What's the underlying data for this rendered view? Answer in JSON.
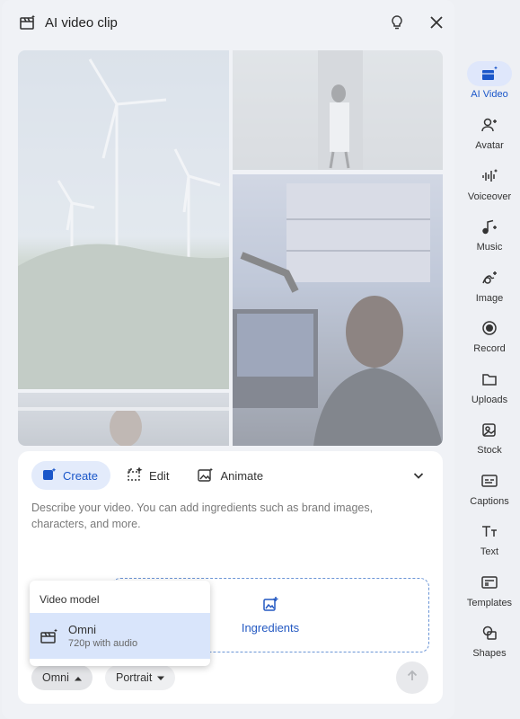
{
  "header": {
    "title": "AI video clip",
    "title_icon": "video-clip-sparkle-icon",
    "tip_icon": "lightbulb-icon",
    "close_icon": "close-icon"
  },
  "composer": {
    "tabs": [
      {
        "label": "Create",
        "icon": "create-sparkle-icon",
        "active": true
      },
      {
        "label": "Edit",
        "icon": "edit-frame-icon",
        "active": false
      },
      {
        "label": "Animate",
        "icon": "animate-image-icon",
        "active": false
      }
    ],
    "prompt_placeholder": "Describe your video. You can add ingredients such as brand images, characters, and more.",
    "ingredients_label": "Ingredients",
    "model_chip": "Omni",
    "aspect_chip": "Portrait"
  },
  "dropdown": {
    "header": "Video model",
    "items": [
      {
        "name": "Omni",
        "detail": "720p with audio",
        "selected": true
      }
    ]
  },
  "sidebar": {
    "items": [
      {
        "label": "AI Video",
        "icon": "ai-video-icon",
        "active": true
      },
      {
        "label": "Avatar",
        "icon": "avatar-icon",
        "active": false
      },
      {
        "label": "Voiceover",
        "icon": "voiceover-icon",
        "active": false
      },
      {
        "label": "Music",
        "icon": "music-icon",
        "active": false
      },
      {
        "label": "Image",
        "icon": "image-icon",
        "active": false
      },
      {
        "label": "Record",
        "icon": "record-icon",
        "active": false
      },
      {
        "label": "Uploads",
        "icon": "folder-icon",
        "active": false
      },
      {
        "label": "Stock",
        "icon": "stock-icon",
        "active": false
      },
      {
        "label": "Captions",
        "icon": "captions-icon",
        "active": false
      },
      {
        "label": "Text",
        "icon": "text-icon",
        "active": false
      },
      {
        "label": "Templates",
        "icon": "templates-icon",
        "active": false
      },
      {
        "label": "Shapes",
        "icon": "shapes-icon",
        "active": false
      }
    ]
  },
  "colors": {
    "accent": "#1a56c9",
    "accent_bg": "#e3ebfb",
    "panel_bg": "#f0f2f6"
  }
}
